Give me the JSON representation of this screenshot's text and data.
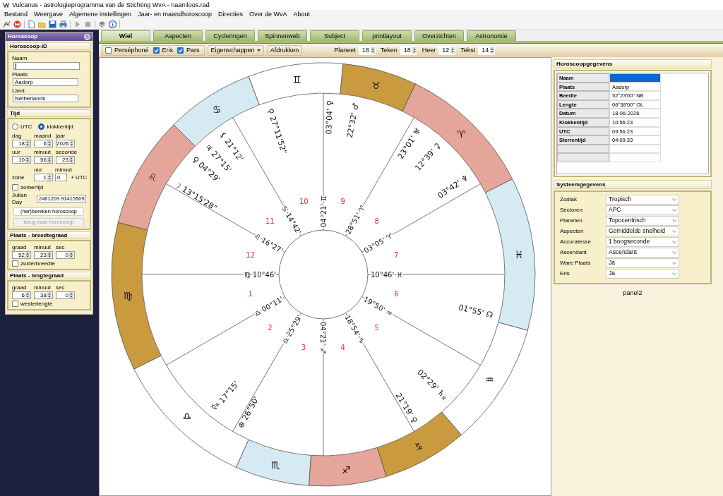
{
  "window": {
    "title": "Vulcanus - astrologieprogramma van de Stichting WvA - naamloos.rad"
  },
  "menu": [
    "Bestand",
    "Weergave",
    "Algemene instellingen",
    "Jaar- en maandhoroscoop",
    "Directies",
    "Over de WvA",
    "About"
  ],
  "toolbar": [
    {
      "kind": "app",
      "disabled": false
    },
    {
      "kind": "help",
      "disabled": false
    },
    {
      "kind": "new",
      "disabled": false
    },
    {
      "kind": "open",
      "disabled": false
    },
    {
      "kind": "save",
      "disabled": false
    },
    {
      "kind": "print",
      "disabled": false
    },
    {
      "kind": "play",
      "disabled": true
    },
    {
      "kind": "stop",
      "disabled": true
    },
    {
      "kind": "layers",
      "disabled": false
    },
    {
      "kind": "info",
      "disabled": false
    }
  ],
  "sidebar": {
    "title": "Horoscoop",
    "id_section": {
      "title": "Horoscoop-ID",
      "fields": [
        {
          "label": "Naam",
          "focused": true
        },
        {
          "label": "Plaats",
          "value": "Aadorp",
          "focused": false
        },
        {
          "label": "Land",
          "value": "Netherlands",
          "focused": false
        }
      ]
    },
    "time_section": {
      "title": "Tijd",
      "modes": [
        {
          "label": "UTC",
          "selected": false
        },
        {
          "label": "klokkentijd",
          "selected": true
        }
      ],
      "date": [
        {
          "label": "dag",
          "value": "18"
        },
        {
          "label": "maand",
          "value": "6"
        },
        {
          "label": "jaar",
          "value": "2026"
        }
      ],
      "time": [
        {
          "label": "uur",
          "value": "10"
        },
        {
          "label": "minuut",
          "value": "56"
        },
        {
          "label": "seconde",
          "value": "23"
        }
      ],
      "zone": {
        "label": "zone",
        "hour_label": "uur",
        "hour": "1",
        "minute_label": "minuut",
        "minute": "0",
        "suffix": "+ UTC"
      },
      "dst": {
        "label": "zomertijd",
        "checked": false
      },
      "julian_day": {
        "label": "Julian Day",
        "value": "2461209.91415509"
      },
      "buttons": [
        {
          "label": "(her)bereken horoscoop",
          "disabled": false
        },
        {
          "label": "terug naar horoscoop",
          "disabled": true
        }
      ]
    },
    "latitude": {
      "title": "Plaats - breedtegraad",
      "fields": [
        {
          "label": "graad",
          "value": "52"
        },
        {
          "label": "minuut",
          "value": "23"
        },
        {
          "label": "sec",
          "value": "0"
        }
      ],
      "option": {
        "label": "zuiderbreedte",
        "checked": false
      }
    },
    "longitude": {
      "title": "Plaats - lengtegraad",
      "fields": [
        {
          "label": "graad",
          "value": "6"
        },
        {
          "label": "minuut",
          "value": "38"
        },
        {
          "label": "sec",
          "value": "0"
        }
      ],
      "option": {
        "label": "westerlengte",
        "checked": false
      }
    }
  },
  "tabs": [
    {
      "label": "Wiel",
      "selected": true
    },
    {
      "label": "Aspecten",
      "selected": false
    },
    {
      "label": "Cycleringen",
      "selected": false
    },
    {
      "label": "Spinnenweb",
      "selected": false
    },
    {
      "label": "Subject",
      "selected": false
    },
    {
      "label": "printlayout",
      "selected": false
    },
    {
      "label": "Overzichten",
      "selected": false
    },
    {
      "label": "Astronomie",
      "selected": false
    }
  ],
  "chart_toolbar": {
    "checkboxes": [
      {
        "label": "Perséphoné",
        "checked": false
      },
      {
        "label": "Eris",
        "checked": true
      },
      {
        "label": "Pars",
        "checked": true
      }
    ],
    "menu_button": "Eigenschappen",
    "print_button": "Afdrukken",
    "spinners": [
      {
        "label": "Planeet",
        "value": "18"
      },
      {
        "label": "Teken",
        "value": "18"
      },
      {
        "label": "Heer",
        "value": "12"
      },
      {
        "label": "Tekst",
        "value": "14"
      }
    ]
  },
  "wheel": {
    "signs": [
      {
        "glyph": "♈",
        "color": "#e4a69a"
      },
      {
        "glyph": "♉",
        "color": "#c99a3e"
      },
      {
        "glyph": "♊",
        "color": "#ffffff"
      },
      {
        "glyph": "♋",
        "color": "#d5eaf2"
      },
      {
        "glyph": "♌",
        "color": "#e4a69a"
      },
      {
        "glyph": "♍",
        "color": "#c99a3e"
      },
      {
        "glyph": "♎",
        "color": "#ffffff"
      },
      {
        "glyph": "♏",
        "color": "#d5eaf2"
      },
      {
        "glyph": "♐",
        "color": "#e4a69a"
      },
      {
        "glyph": "♑",
        "color": "#c99a3e"
      },
      {
        "glyph": "♒",
        "color": "#ffffff"
      },
      {
        "glyph": "♓",
        "color": "#d5eaf2"
      }
    ],
    "cusps": [
      {
        "number": "1",
        "sign": "♍",
        "degree": "10°46'"
      },
      {
        "number": "2",
        "sign": "♎",
        "degree": "00°11'"
      },
      {
        "number": "3",
        "sign": "♎",
        "degree": "25°29'"
      },
      {
        "number": "4",
        "sign": "♐",
        "degree": "04°21'"
      },
      {
        "number": "5",
        "sign": "♑",
        "degree": "18°54'"
      },
      {
        "number": "6",
        "sign": "♒",
        "degree": "19°50'"
      },
      {
        "number": "7",
        "sign": "♓",
        "degree": "10°46'"
      },
      {
        "number": "8",
        "sign": "♈",
        "degree": "03°05'"
      },
      {
        "number": "9",
        "sign": "♈",
        "degree": "28°51'"
      },
      {
        "number": "10",
        "sign": "♊",
        "degree": "04°21'"
      },
      {
        "number": "11",
        "sign": "♋",
        "degree": "14°42'"
      },
      {
        "number": "12",
        "sign": "♌",
        "degree": "16°27'"
      }
    ],
    "planets": [
      {
        "glyph": "☽",
        "position": "13°15'28\""
      },
      {
        "glyph": "♀",
        "position": "04°29'"
      },
      {
        "glyph": "♃",
        "position": "27°15'"
      },
      {
        "glyph": "⚸",
        "position": "21°12'"
      },
      {
        "glyph": "⚲",
        "position": "27°11'52\""
      },
      {
        "glyph": "♀",
        "position": "03°04'"
      },
      {
        "glyph": "♂",
        "position": "22°32'"
      },
      {
        "glyph": "♅",
        "position": "23°01'"
      },
      {
        "glyph": "⚳",
        "position": "12°39'"
      },
      {
        "glyph": "♆",
        "position": "03°42'"
      },
      {
        "glyph": "☊",
        "position": "01°55'"
      },
      {
        "glyph": "♄",
        "retro": "R",
        "position": "02°29'"
      },
      {
        "glyph": "♀",
        "position": "21°19'"
      },
      {
        "glyph": "☿",
        "retro": "R",
        "position": "17°15'"
      },
      {
        "glyph": "⊕",
        "position": "26°50'"
      }
    ]
  },
  "horoscope_data": {
    "title": "Horoscoopgegevens",
    "rows": [
      {
        "label": "Naam",
        "selected": true
      },
      {
        "label": "Plaats",
        "value": "Aadorp",
        "selected": false
      },
      {
        "label": "Beedte",
        "value": "52°23'00\"  NB",
        "selected": false
      },
      {
        "label": "Lengte",
        "value": "06°38'00\"  OL",
        "selected": false
      },
      {
        "label": "Datum",
        "value": "18-06-2026",
        "selected": false
      },
      {
        "label": "Klokkentijd",
        "value": "10:56:23",
        "selected": false
      },
      {
        "label": "UTC",
        "value": "09:56:23",
        "selected": false
      },
      {
        "label": "Sterrentijd",
        "value": "04:09:33",
        "selected": false
      }
    ]
  },
  "system_data": {
    "title": "Systeemgegevens",
    "settings": [
      {
        "label": "Zodiak",
        "value": "Tropisch"
      },
      {
        "label": "Sectoren",
        "value": "APC"
      },
      {
        "label": "Planeten",
        "value": "Topocentrisch"
      },
      {
        "label": "Aspecten",
        "value": "Gemiddelde snelheid"
      },
      {
        "label": "Accuratesse",
        "value": "1 boogseconde"
      },
      {
        "label": "Ascendant",
        "value": "Ascendant"
      },
      {
        "label": "Ware Plaats",
        "value": "Ja"
      },
      {
        "label": "Eris",
        "value": "Ja"
      }
    ]
  },
  "panel_label": "panel2"
}
